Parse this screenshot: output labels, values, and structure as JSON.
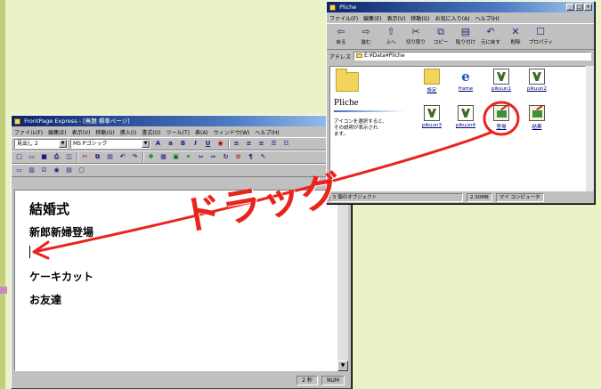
{
  "colors": {
    "background": "#eaf3c6",
    "annotation": "#e8241c",
    "title_bar": "#0a246a"
  },
  "frontpage": {
    "title": "FrontPage Express - [無題 標準ページ]",
    "menu": [
      "ファイル(F)",
      "編集(E)",
      "表示(V)",
      "移動(G)",
      "挿入(I)",
      "書式(O)",
      "ツール(T)",
      "表(A)",
      "ウィンドウ(W)",
      "ヘルプ(H)"
    ],
    "style_value": "見出し 2",
    "font_value": "MS Pゴシック",
    "doc": {
      "heading": "結婚式",
      "line1": "新郎新婦登場",
      "line2": "ケーキカット",
      "line3": "お友達"
    },
    "status_time": "2 秒",
    "status_num": "NUM"
  },
  "explorer": {
    "title": "Pliche",
    "menu": [
      "ファイル(F)",
      "編集(E)",
      "表示(V)",
      "移動(G)",
      "お気に入り(A)",
      "ヘルプ(H)"
    ],
    "toolbar": [
      "戻る",
      "進む",
      "上へ",
      "切り取り",
      "コピー",
      "貼り付け",
      "元に戻す",
      "削除",
      "プロパティ"
    ],
    "address_label": "アドレス",
    "address_value": "E:¥Data¥Pliche",
    "folder_name": "Pliche",
    "hint": "アイコンを選択すると、\nその説明が表示され\nます。",
    "items_row1": [
      "設定",
      "frame",
      "pikuun1",
      "pikuun2"
    ],
    "items_row2": [
      "pikuun3",
      "pikuun4",
      "登場",
      "結果"
    ],
    "status_objects": "5 個のオブジェクト",
    "status_size": "2.30MB",
    "status_zone": "マイ コンピュータ"
  },
  "annotation": {
    "label": "ドラッグ"
  }
}
